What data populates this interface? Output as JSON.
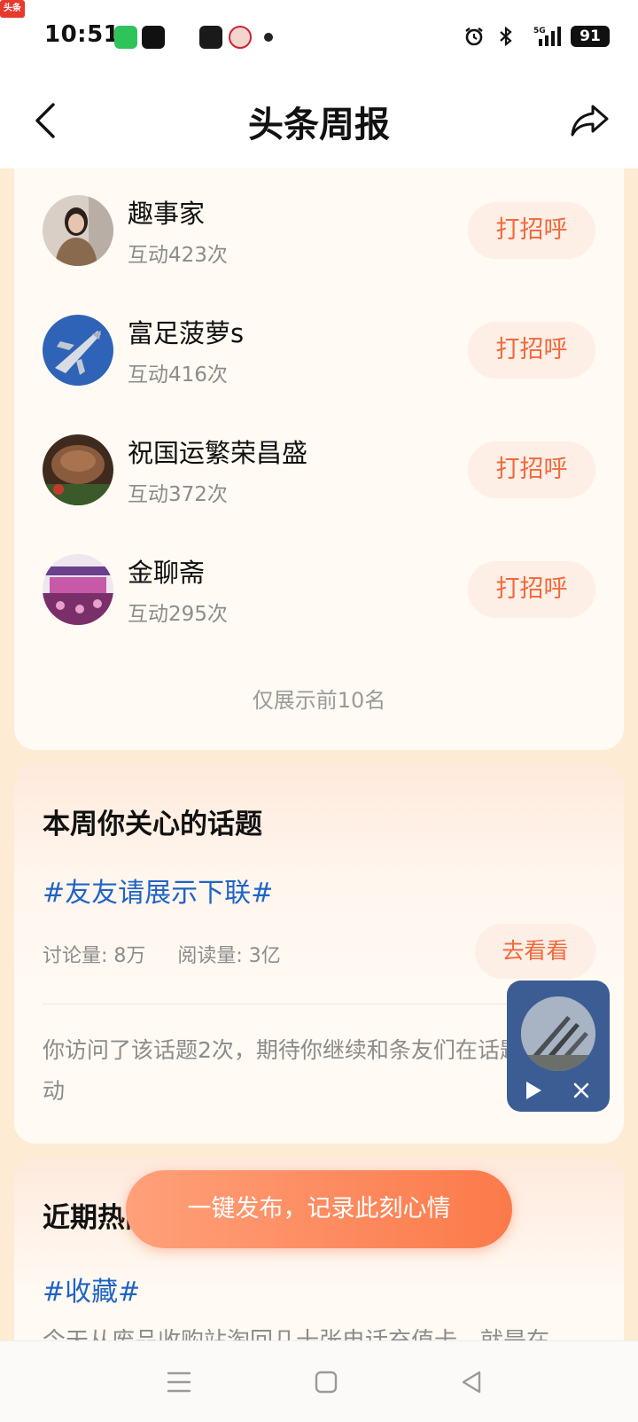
{
  "status_bar": {
    "time": "10:51",
    "toutiao_badge": "头条",
    "battery": "91",
    "network": "5G"
  },
  "header": {
    "title": "头条周报",
    "back_icon": "chevron-left-icon",
    "share_icon": "share-icon"
  },
  "contacts": [
    {
      "name": "趣事家",
      "meta": "互动423次",
      "button": "打招呼"
    },
    {
      "name": "富足菠萝s",
      "meta": "互动416次",
      "button": "打招呼"
    },
    {
      "name": "祝国运繁荣昌盛",
      "meta": "互动372次",
      "button": "打招呼"
    },
    {
      "name": "金聊斋",
      "meta": "互动295次",
      "button": "打招呼"
    }
  ],
  "contacts_footer": "仅展示前10名",
  "topic_card": {
    "title": "本周你关心的话题",
    "tag": "#友友请展示下联#",
    "discussion": "讨论量: 8万",
    "reads": "阅读量: 3亿",
    "button": "去看看",
    "visit_text": "你访问了该话题2次，期待你继续和条友们在话题中互动"
  },
  "hot_card": {
    "title": "近期热门话题",
    "tag": "#收藏#",
    "text": "今天从废品收购站淘回几十张电话充值卡，就是在"
  },
  "publish_button": "一键发布，记录此刻心情",
  "colors": {
    "accent": "#f06a3a",
    "link": "#1f63c6",
    "page_bg": "#fdebd4",
    "card_bg": "#fffaf3"
  }
}
